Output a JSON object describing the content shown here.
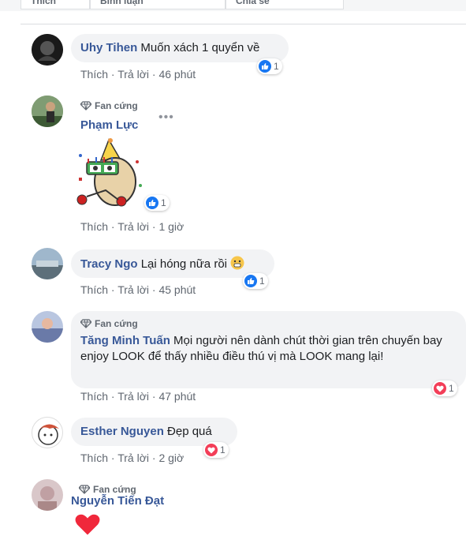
{
  "top_buttons": [
    "Thích",
    "Bình luận",
    "Chia sẻ"
  ],
  "comments": [
    {
      "name": "Uhy Tihen",
      "text": "Muốn xách 1 quyển về",
      "like": "Thích",
      "reply": "Trả lời",
      "time": "46 phút",
      "reaction_count": "1",
      "reaction": "like-icon"
    },
    {
      "badge": "Fan cứng",
      "name": "Phạm Lực",
      "like": "Thích",
      "reply": "Trả lời",
      "time": "1 giờ",
      "reaction_count": "1",
      "reaction": "like-icon",
      "more": "•••"
    },
    {
      "name": "Tracy Ngo",
      "text": "Lại hóng nữa rồi",
      "like": "Thích",
      "reply": "Trả lời",
      "time": "45 phút",
      "reaction_count": "1",
      "reaction": "like-icon"
    },
    {
      "badge": "Fan cứng",
      "name": "Tăng Minh Tuấn",
      "text": "Mọi người nên dành chút thời gian trên chuyến bay enjoy LOOK để thấy nhiều điều thú vị mà LOOK mang lại!",
      "like": "Thích",
      "reply": "Trả lời",
      "time": "47 phút",
      "reaction_count": "1",
      "reaction": "love-icon"
    },
    {
      "name": "Esther Nguyen",
      "text": "Đẹp quá",
      "like": "Thích",
      "reply": "Trả lời",
      "time": "2 giờ",
      "reaction_count": "1",
      "reaction": "love-icon"
    },
    {
      "badge": "Fan cứng",
      "name": "Nguyễn Tiến Đạt"
    }
  ],
  "colors": {
    "link": "#385898",
    "meta": "#606770",
    "bubble": "#f2f3f5",
    "like": "#1877f2",
    "love": "#f33e58"
  }
}
